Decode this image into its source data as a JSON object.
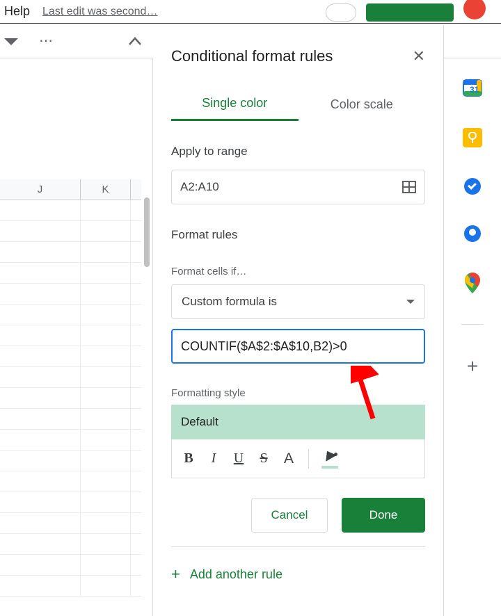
{
  "menu": {
    "help": "Help",
    "last_edit": "Last edit was second…"
  },
  "sheet": {
    "columns": [
      "J",
      "K"
    ]
  },
  "panel": {
    "title": "Conditional format rules",
    "tabs": {
      "single": "Single color",
      "scale": "Color scale"
    },
    "apply_range_label": "Apply to range",
    "apply_range_value": "A2:A10",
    "format_rules_label": "Format rules",
    "format_cells_if_label": "Format cells if…",
    "condition_type": "Custom formula is",
    "formula_value": "COUNTIF($A$2:$A$10,B2)>0",
    "formatting_style_label": "Formatting style",
    "style_preview": "Default",
    "buttons": {
      "cancel": "Cancel",
      "done": "Done"
    },
    "add_another": "Add another rule"
  }
}
